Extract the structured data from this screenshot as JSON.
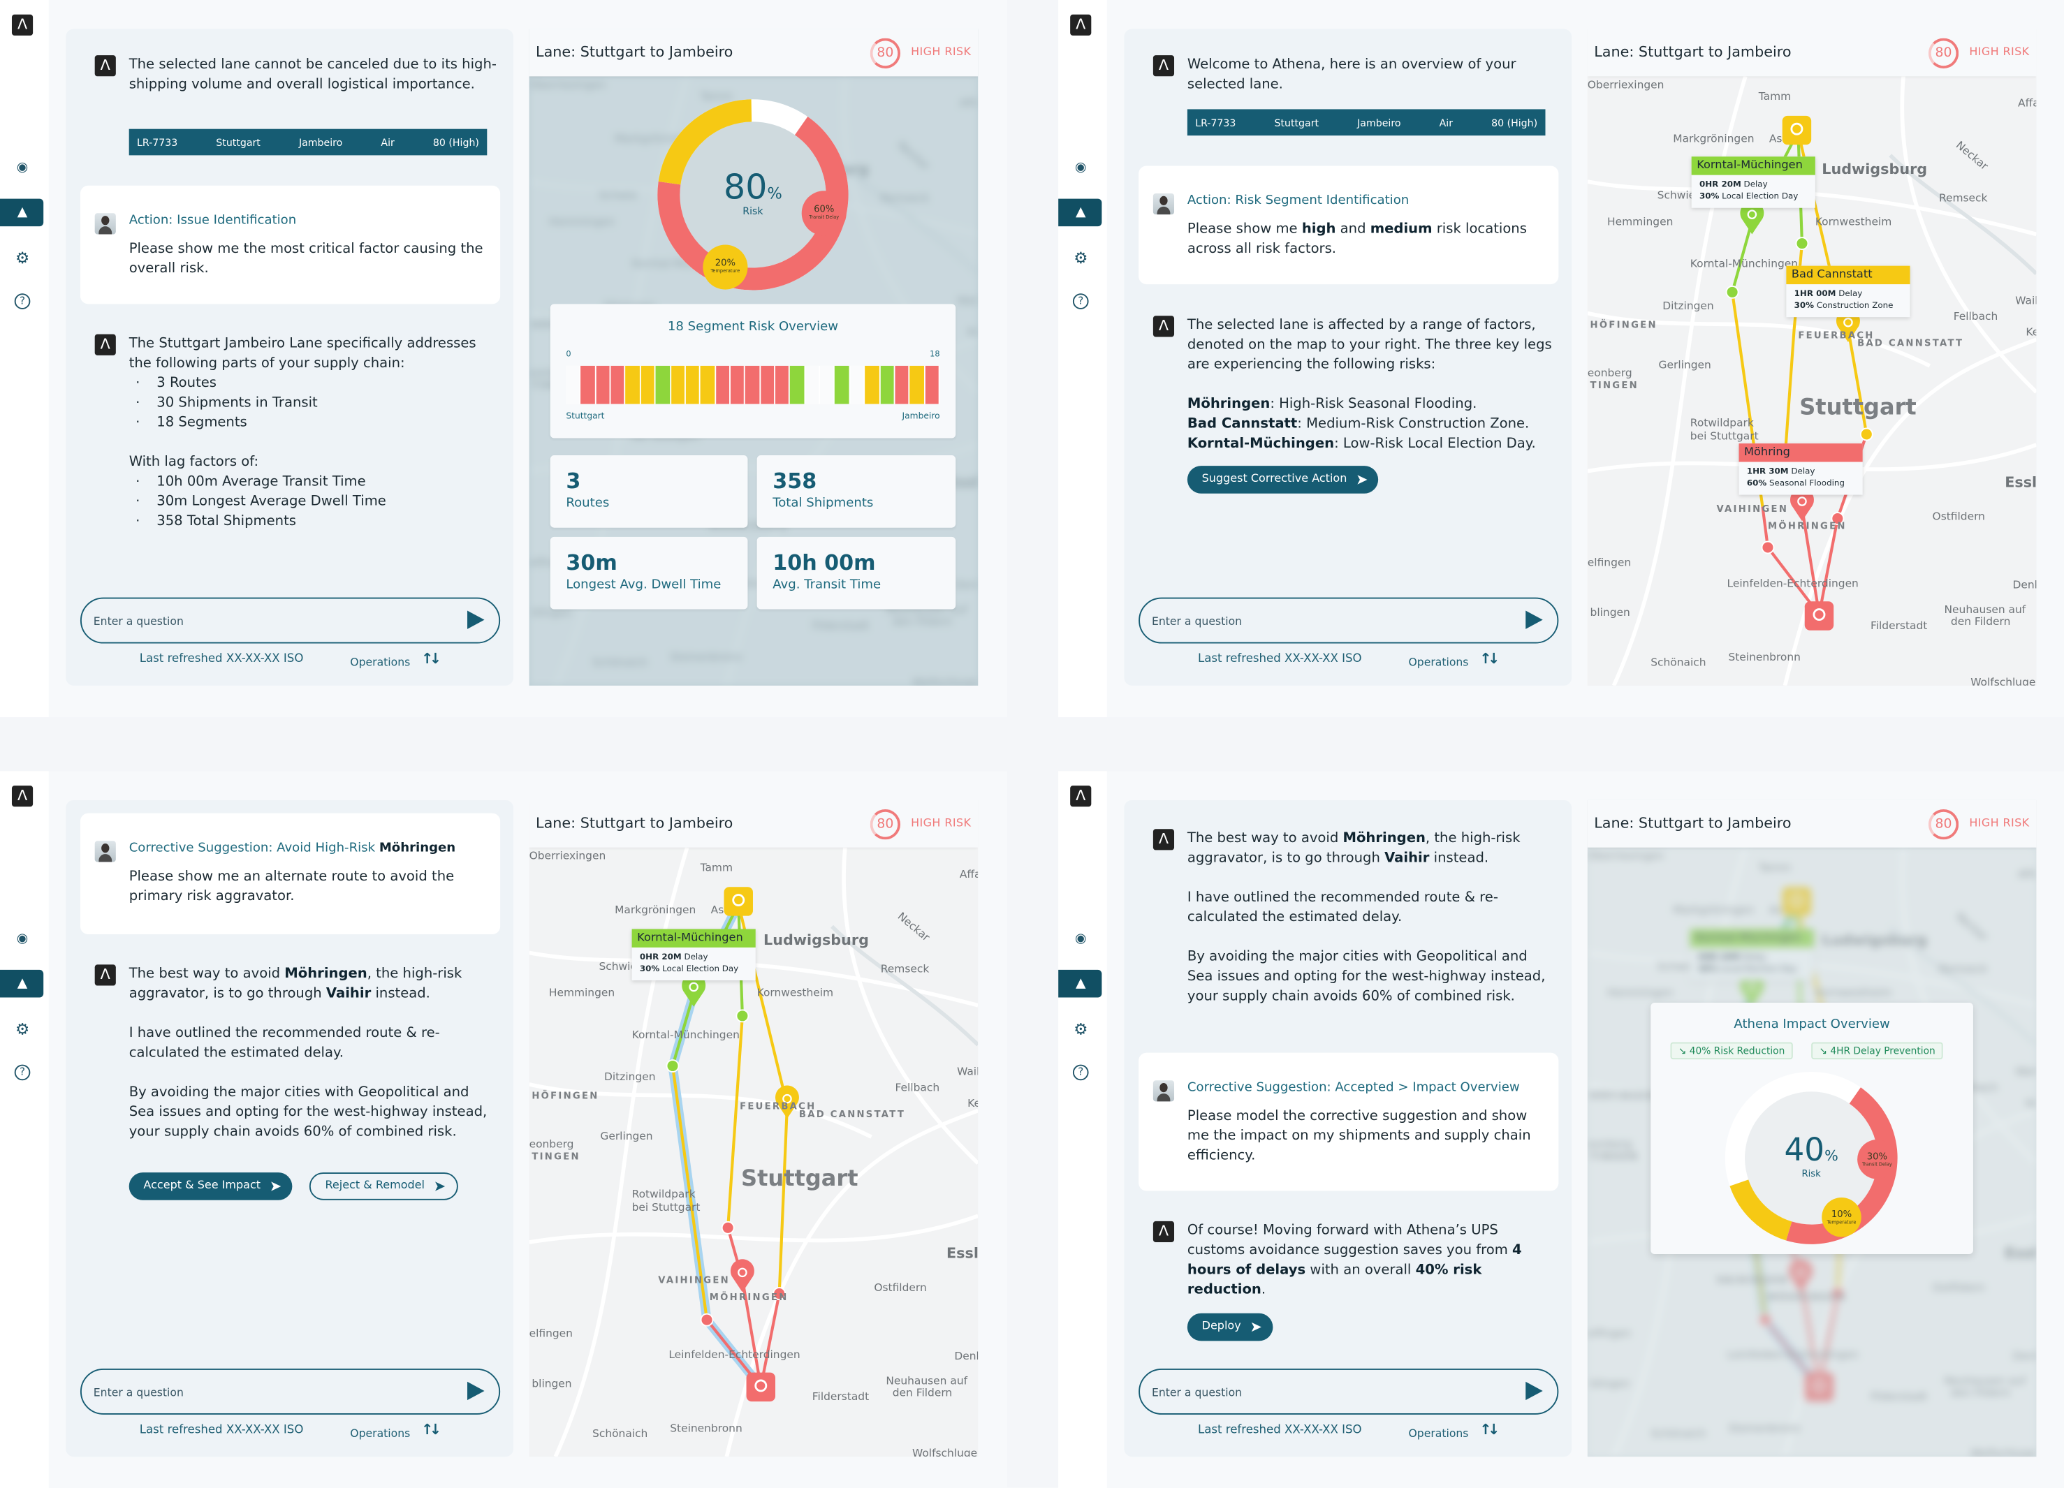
{
  "sidebar": {
    "logo": "athena-logo",
    "icons": [
      "eye-icon",
      "alert-icon",
      "gear-icon",
      "help-icon"
    ],
    "active": "alert-icon"
  },
  "lane": {
    "title": "Lane: Stuttgart to Jambeiro",
    "risk_score": "80",
    "risk_label": "HIGH RISK",
    "table": [
      "LR-7733",
      "Stuttgart",
      "Jambeiro",
      "Air",
      "80 (High)"
    ]
  },
  "input": {
    "placeholder": "Enter a question"
  },
  "footer": {
    "refreshed": "Last refreshed XX-XX-XX ISO",
    "operations": "Operations"
  },
  "colors": {
    "accent": "#165c73",
    "high": "#f26d6d",
    "medium": "#f6c914",
    "low": "#8ed63c",
    "route_alt": "#a8d4f0"
  },
  "screen1": {
    "bot1": "The selected lane cannot be canceled due to its high-shipping volume and overall logistical importance.",
    "user": {
      "title": "Action: Issue Identification",
      "body": "Please show me the most critical factor causing the overall risk."
    },
    "bot2": {
      "intro": "The Stuttgart Jambeiro Lane specifically addresses the following parts of your supply chain:",
      "bullets1": [
        "3 Routes",
        "30 Shipments in Transit",
        "18 Segments"
      ],
      "intro2": "With lag factors of:",
      "bullets2": [
        "10h 00m Average Transit Time",
        "30m Longest Average Dwell Time",
        "358 Total Shipments"
      ]
    },
    "donut": {
      "value": "80",
      "unit": "%",
      "label": "Risk",
      "slices": [
        {
          "pct": "60%",
          "label": "Transit Delay",
          "level": "high",
          "share": 60
        },
        {
          "pct": "20%",
          "label": "Temperature",
          "level": "medium",
          "share": 20
        }
      ]
    },
    "segments": {
      "title": "18 Segment Risk Overview",
      "min": "0",
      "max": "18",
      "start": "Stuttgart",
      "end": "Jambeiro",
      "cells": [
        "none",
        "high",
        "high",
        "high",
        "medium",
        "medium",
        "low",
        "medium",
        "medium",
        "medium",
        "high",
        "high",
        "high",
        "high",
        "high",
        "low",
        "none",
        "none",
        "low",
        "none",
        "medium",
        "low",
        "high",
        "medium",
        "high"
      ]
    },
    "stats": [
      {
        "value": "3",
        "label": "Routes"
      },
      {
        "value": "358",
        "label": "Total Shipments"
      },
      {
        "value": "30m",
        "label": "Longest Avg. Dwell Time"
      },
      {
        "value": "10h 00m",
        "label": "Avg. Transit Time"
      }
    ]
  },
  "screen2": {
    "bot1": "Welcome to Athena, here is an overview of your selected lane.",
    "user": {
      "title": "Action: Risk Segment Identification",
      "body": [
        {
          "text": "Please show me "
        },
        {
          "text": "high",
          "bold": true
        },
        {
          "text": " and "
        },
        {
          "text": "medium",
          "bold": true
        },
        {
          "text": " risk locations across all risk factors."
        }
      ]
    },
    "bot2": {
      "intro": "The selected lane is affected by a range of factors, denoted on the map to your right. The three key legs are experiencing the following risks:",
      "risks": [
        [
          {
            "text": "Möhringen",
            "bold": true
          },
          {
            "text": ": High-Risk Seasonal Flooding."
          }
        ],
        [
          {
            "text": "Bad Cannstatt",
            "bold": true
          },
          {
            "text": ": Medium-Risk Construction Zone."
          }
        ],
        [
          {
            "text": "Korntal-Müchingen",
            "bold": true
          },
          {
            "text": ": Low-Risk Local Election Day."
          }
        ]
      ],
      "button": "Suggest Corrective Action"
    }
  },
  "screen3": {
    "user": {
      "title": [
        {
          "text": "Corrective Suggestion: Avoid High-Risk "
        },
        {
          "text": "Möhringen",
          "bold": true
        }
      ],
      "body": "Please show me an alternate route to avoid the primary risk aggravator."
    },
    "buttons": {
      "accept": "Accept & See Impact",
      "reject": "Reject & Remodel"
    }
  },
  "route_reply": [
    [
      {
        "text": "The best way to avoid "
      },
      {
        "text": "Möhringen",
        "bold": true
      },
      {
        "text": ", the high-risk aggravator, is to go through "
      },
      {
        "text": "Vaihir",
        "bold": true
      },
      {
        "text": " instead."
      }
    ],
    [
      {
        "text": "I have outlined the recommended route & re-calculated the estimated delay."
      }
    ],
    [
      {
        "text": "By avoiding the major cities with Geopolitical and Sea issues and opting for the west-highway instead, your supply chain avoids 60% of combined risk."
      }
    ]
  ],
  "screen4": {
    "user": {
      "title": "Corrective Suggestion: Accepted > Impact Overview",
      "body": "Please model the corrective suggestion and show me the impact on my shipments and supply chain efficiency."
    },
    "bot": [
      {
        "text": "Of course! Moving forward with Athena’s UPS customs avoidance suggestion saves you from "
      },
      {
        "text": "4 hours of delays",
        "bold": true
      },
      {
        "text": " with an overall "
      },
      {
        "text": "40% risk reduction",
        "bold": true
      },
      {
        "text": "."
      }
    ],
    "button": "Deploy",
    "impact": {
      "title": "Athena Impact Overview",
      "chips": [
        "40% Risk Reduction",
        "4HR Delay Prevention"
      ],
      "chip_icon": "trend-down-icon",
      "donut": {
        "value": "40",
        "unit": "%",
        "label": "Risk",
        "slices": [
          {
            "pct": "30%",
            "label": "Transit Delay",
            "level": "high",
            "share": 30
          },
          {
            "pct": "10%",
            "label": "Temperature",
            "level": "medium",
            "share": 10
          }
        ]
      }
    }
  },
  "map": {
    "places": [
      "Oberriexingen",
      "Tamm",
      "Affa",
      "Markgröningen",
      "As",
      "Ludwigsburg",
      "Neckar",
      "Remseck",
      "Schwie",
      "Hemmingen",
      "Kornwestheim",
      "Korntal-Münchingen",
      "Ditzingen",
      "Waib",
      "Fellbach",
      "HÖFINGEN",
      "Ke",
      "FEUERBACH",
      "BAD CANNSTATT",
      "Gerlingen",
      "eonberg",
      "TINGEN",
      "Stuttgart",
      "Rotwildpark",
      "bei Stuttgart",
      "Essli",
      "VAIHINGEN",
      "MÖHRINGEN",
      "Ostfildern",
      "elfingen",
      "Leinfelden-Echterdingen",
      "Denk",
      "blingen",
      "Neuhausen auf",
      "den Fildern",
      "Filderstadt",
      "Schönaich",
      "Steinenbronn",
      "Wolfschlugen"
    ],
    "callouts": [
      {
        "name": "Korntal-Müchingen",
        "delay": "0HR 20M",
        "delay_label": "Delay",
        "pct": "30%",
        "reason": "Local Election Day",
        "level": "low"
      },
      {
        "name": "Bad Cannstatt",
        "delay": "1HR 00M",
        "delay_label": "Delay",
        "pct": "30%",
        "reason": "Construction Zone",
        "level": "medium"
      },
      {
        "name": "Möhring",
        "delay": "1HR 30M",
        "delay_label": "Delay",
        "pct": "60%",
        "reason": "Seasonal Flooding",
        "level": "high"
      }
    ]
  }
}
